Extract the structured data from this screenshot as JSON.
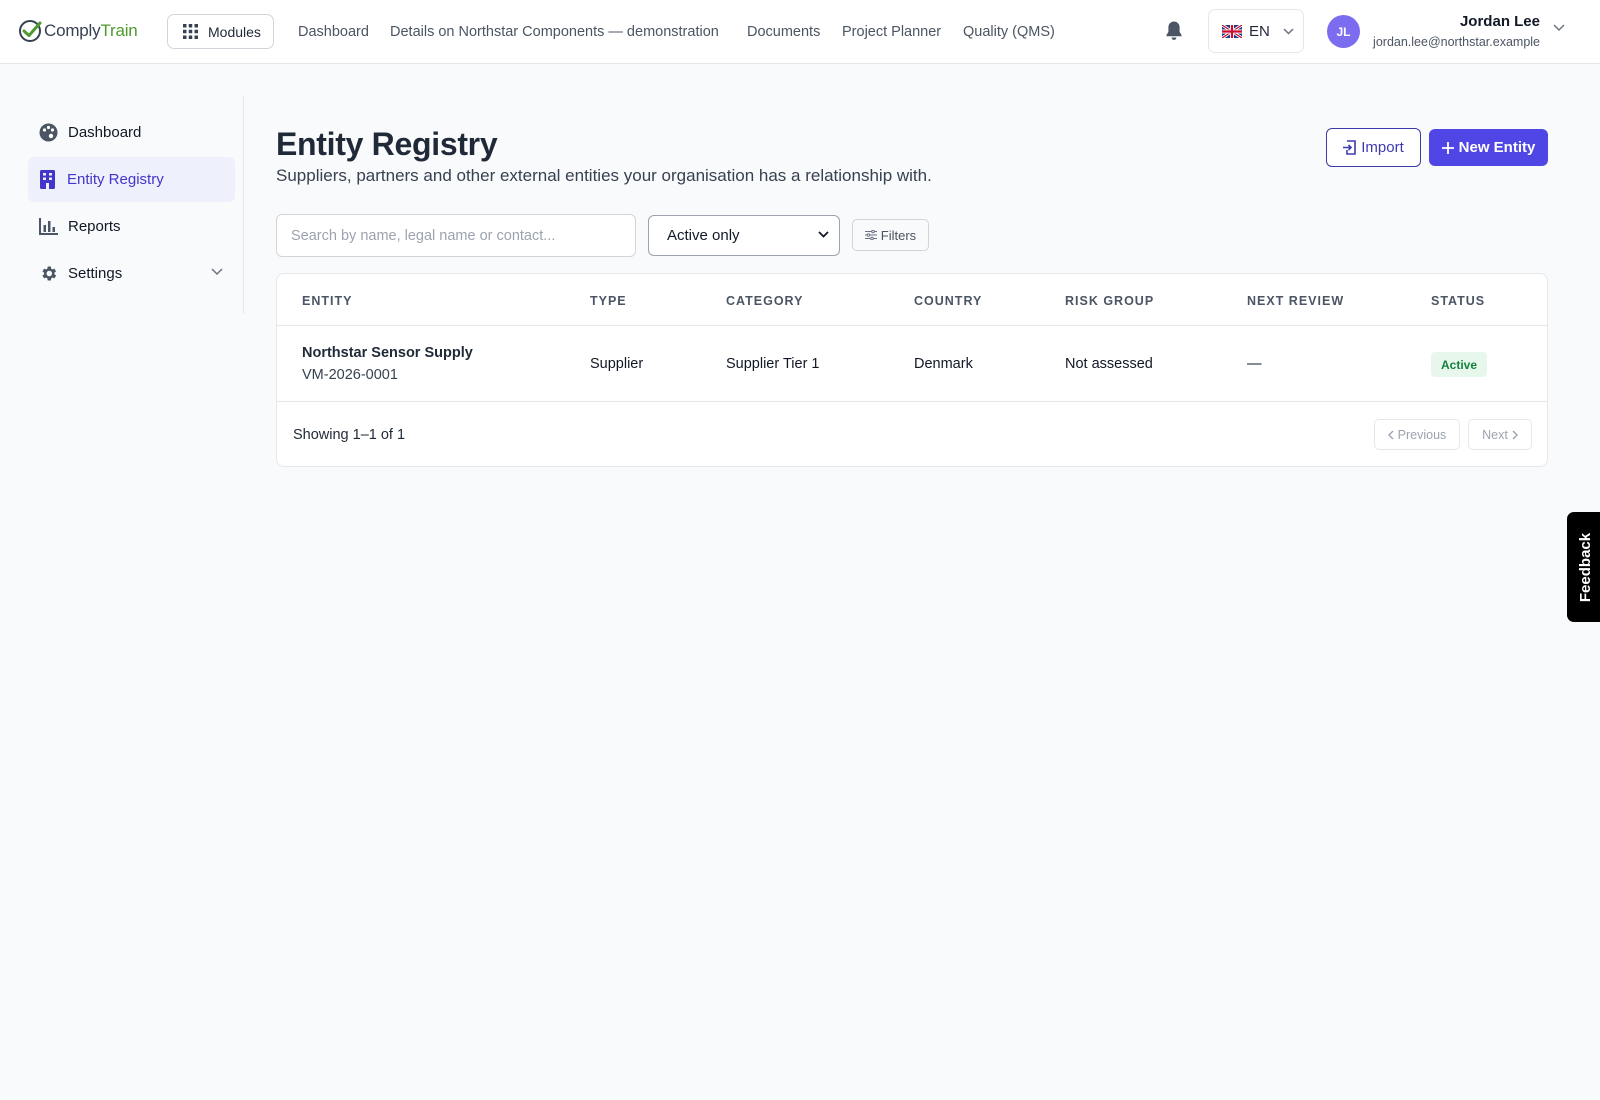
{
  "brand": {
    "name_part1": "Comply",
    "name_part2": "Train"
  },
  "topbar": {
    "modules_label": "Modules",
    "nav": [
      "Dashboard",
      "Details on Northstar Components — demonstration",
      "Documents",
      "Project Planner",
      "Quality (QMS)"
    ],
    "language": "EN",
    "user": {
      "initials": "JL",
      "name": "Jordan Lee",
      "email": "jordan.lee@northstar.example"
    }
  },
  "sidebar": {
    "items": [
      {
        "label": "Dashboard",
        "icon": "palette-icon"
      },
      {
        "label": "Entity Registry",
        "icon": "building-icon",
        "active": true
      },
      {
        "label": "Reports",
        "icon": "bar-chart-icon"
      },
      {
        "label": "Settings",
        "icon": "gear-icon"
      }
    ]
  },
  "page": {
    "title": "Entity Registry",
    "subtitle": "Suppliers, partners and other external entities your organisation has a relationship with.",
    "import_label": "Import",
    "new_label": "New Entity"
  },
  "filters": {
    "search_placeholder": "Search by name, legal name or contact...",
    "status_selected": "Active only",
    "filters_label": "Filters"
  },
  "table": {
    "columns": [
      "ENTITY",
      "TYPE",
      "CATEGORY",
      "COUNTRY",
      "RISK GROUP",
      "NEXT REVIEW",
      "STATUS"
    ],
    "rows": [
      {
        "name": "Northstar Sensor Supply",
        "code": "VM-2026-0001",
        "type": "Supplier",
        "category": "Supplier Tier 1",
        "country": "Denmark",
        "risk_group": "Not assessed",
        "next_review": "—",
        "status": "Active"
      }
    ],
    "showing": "Showing 1–1 of 1",
    "prev_label": "Previous",
    "next_label": "Next"
  },
  "feedback_label": "Feedback",
  "colors": {
    "accent": "#4f46e5",
    "active_bg": "#eef0fb",
    "status_active": "#15803d",
    "brand_green": "#4d9a2e"
  }
}
